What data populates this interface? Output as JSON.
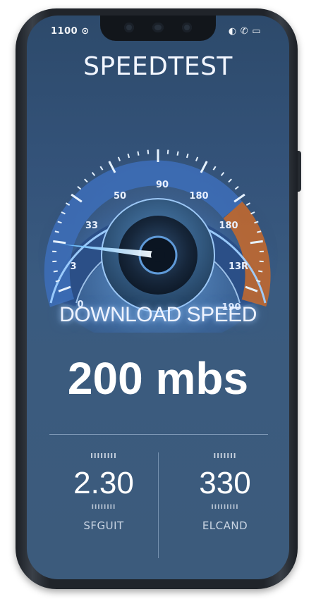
{
  "status_bar": {
    "left": "1100 ⊙",
    "right": "◐ ✆ ▭"
  },
  "app": {
    "title": "SPEEDTEST"
  },
  "gauge": {
    "ticks": [
      "0",
      "3",
      "33",
      "50",
      "90",
      "180",
      "180",
      "13R",
      "190"
    ],
    "needle_value_fraction": 0.12,
    "colors": {
      "ring_glow": "#5fa8ff",
      "ring_high": "#d7702f",
      "needle": "#8fd8ff"
    }
  },
  "download": {
    "label": "DOWNLOAD SPEED",
    "value": "200 mbs"
  },
  "stats": {
    "left": {
      "caption": "ⅠⅠⅠⅠⅠⅠⅠⅠ",
      "value": "2.30",
      "sub": "ⅠⅠⅠⅠⅠⅠⅠⅠ",
      "name": "SFGUIT"
    },
    "right": {
      "caption": "ⅠⅠⅠⅠⅠⅠⅠ",
      "value": "330",
      "sub": "ⅠⅠⅠⅠⅠⅠⅠⅠⅠ",
      "name": "ELCAND"
    }
  }
}
